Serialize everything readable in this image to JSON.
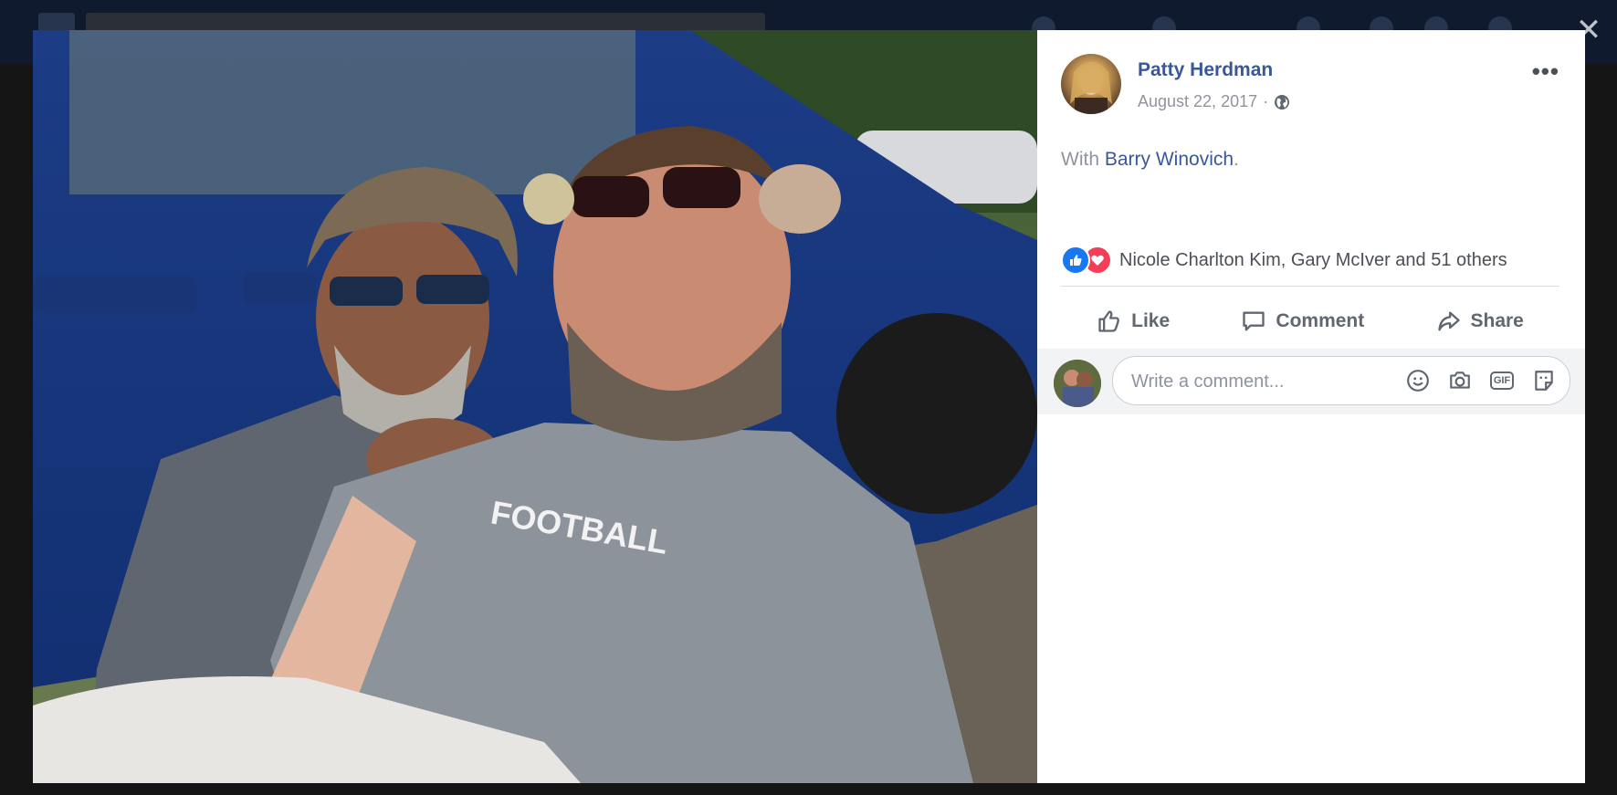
{
  "post": {
    "author": "Patty Herdman",
    "date": "August 22, 2017",
    "separator": "·",
    "with_prefix": "With",
    "tagged_person": "Barry Winovich",
    "with_suffix": ".",
    "reactions_text": "Nicole Charlton Kim, Gary McIver and 51 others"
  },
  "actions": {
    "like": "Like",
    "comment": "Comment",
    "share": "Share"
  },
  "comment": {
    "placeholder": "Write a comment..."
  },
  "photo": {
    "shirt_text": "FOOTBALL"
  },
  "icons": {
    "close": "close-icon",
    "more": "more-options-icon",
    "privacy": "globe-icon",
    "like_reaction": "like-reaction-icon",
    "love_reaction": "love-reaction-icon",
    "emoji": "emoji-icon",
    "camera": "camera-icon",
    "gif": "gif-icon",
    "sticker": "sticker-icon"
  },
  "colors": {
    "link": "#385898",
    "like_blue": "#1877f2",
    "love_red": "#f33e58"
  }
}
